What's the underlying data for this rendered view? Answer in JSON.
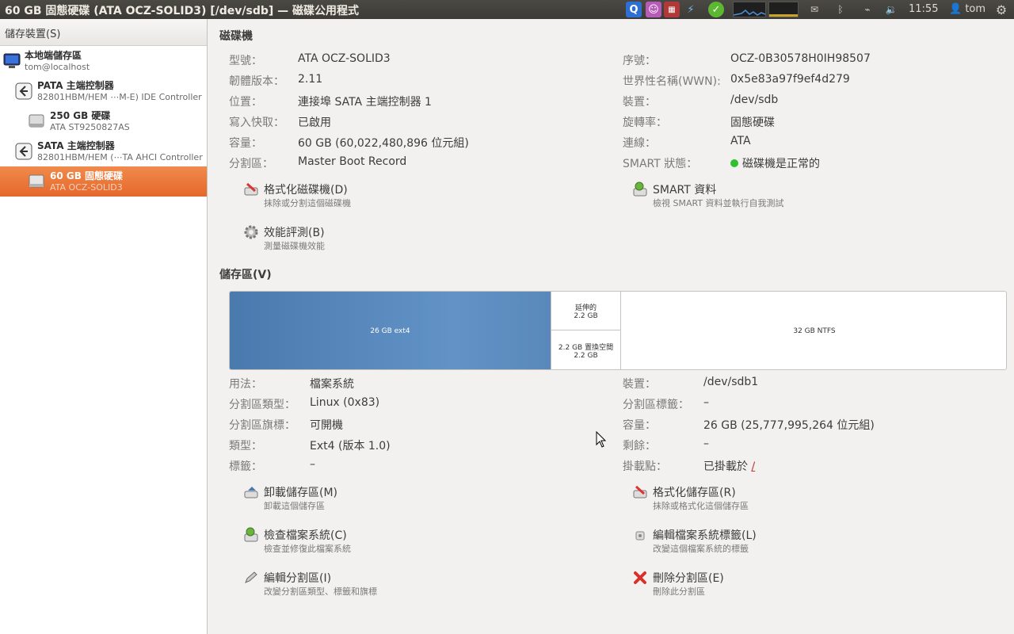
{
  "window_title": "60 GB 固態硬碟 (ATA OCZ-SOLID3) [/dev/sdb] — 磁碟公用程式",
  "panel": {
    "clock": "11:55",
    "user": "tom"
  },
  "sidebar": {
    "header": "儲存裝置(S)",
    "items": [
      {
        "label": "本地端儲存區",
        "sub": "tom@localhost",
        "icon": "computer-icon"
      },
      {
        "label": "PATA 主端控制器",
        "sub": "82801HBM/HEM ⋯M-E) IDE Controller",
        "icon": "controller-icon"
      },
      {
        "label": "250 GB 硬碟",
        "sub": "ATA ST9250827AS",
        "icon": "harddisk-icon"
      },
      {
        "label": "SATA 主端控制器",
        "sub": "82801HBM/HEM (⋯TA AHCI Controller",
        "icon": "controller-icon"
      },
      {
        "label": "60 GB 固態硬碟",
        "sub": "ATA OCZ-SOLID3",
        "icon": "harddisk-icon",
        "selected": true
      }
    ]
  },
  "drive": {
    "title": "磁碟機",
    "left": [
      {
        "label": "型號：",
        "value": "ATA OCZ-SOLID3"
      },
      {
        "label": "韌體版本：",
        "value": "2.11"
      },
      {
        "label": "位置：",
        "value": "連接埠 SATA 主端控制器 1"
      },
      {
        "label": "寫入快取：",
        "value": "已啟用"
      },
      {
        "label": "容量：",
        "value": "60 GB (60,022,480,896 位元組)"
      },
      {
        "label": "分割區：",
        "value": "Master Boot Record"
      }
    ],
    "right": [
      {
        "label": "序號：",
        "value": "OCZ-0B30578H0IH98507"
      },
      {
        "label": "世界性名稱(WWN):",
        "value": "0x5e83a97f9ef4d279"
      },
      {
        "label": "裝置：",
        "value": "/dev/sdb"
      },
      {
        "label": "旋轉率：",
        "value": "固態硬碟"
      },
      {
        "label": "連線：",
        "value": "ATA"
      },
      {
        "label": "SMART 狀態：",
        "value": "磁碟機是正常的"
      }
    ],
    "actions": [
      {
        "title": "格式化磁碟機(D)",
        "desc": "抹除或分割這個磁碟機"
      },
      {
        "title": "SMART 資料",
        "desc": "檢視 SMART 資料並執行自我測試"
      },
      {
        "title": "效能評測(B)",
        "desc": "測量磁碟機效能"
      }
    ]
  },
  "volumes": {
    "title": "儲存區(V)",
    "map": {
      "main": "26 GB ext4",
      "extended_line1": "延伸的",
      "extended_line2": "2.2 GB",
      "swap_line1": "2.2 GB 置換空間",
      "swap_line2": "2.2 GB",
      "ntfs": "32 GB NTFS"
    },
    "left": [
      {
        "label": "用法：",
        "value": "檔案系統"
      },
      {
        "label": "分割區類型：",
        "value": "Linux (0x83)"
      },
      {
        "label": "分割區旗標：",
        "value": "可開機"
      },
      {
        "label": "類型：",
        "value": "Ext4 (版本 1.0)"
      },
      {
        "label": "標籤：",
        "value": "–"
      }
    ],
    "right": [
      {
        "label": "裝置：",
        "value": "/dev/sdb1"
      },
      {
        "label": "分割區標籤：",
        "value": "–"
      },
      {
        "label": "容量：",
        "value": "26 GB (25,777,995,264 位元組)"
      },
      {
        "label": "剩餘：",
        "value": "–"
      },
      {
        "label": "掛載點：",
        "value_prefix": "已掛載於",
        "value_link": "/"
      }
    ],
    "actions": [
      {
        "title": "卸載儲存區(M)",
        "desc": "卸載這個儲存區"
      },
      {
        "title": "格式化儲存區(R)",
        "desc": "抹除或格式化這個儲存區"
      },
      {
        "title": "檢查檔案系統(C)",
        "desc": "檢查並修復此檔案系統"
      },
      {
        "title": "編輯檔案系統標籤(L)",
        "desc": "改變這個檔案系統的標籤"
      },
      {
        "title": "編輯分割區(I)",
        "desc": "改變分割區類型、標籤和旗標"
      },
      {
        "title": "刪除分割區(E)",
        "desc": "刪除此分割區"
      }
    ]
  },
  "colors": {
    "selection": "#e96f33",
    "volume_main": "#5b8cc0",
    "smart_ok": "#2fbf2f",
    "delete_red": "#d9302c"
  }
}
